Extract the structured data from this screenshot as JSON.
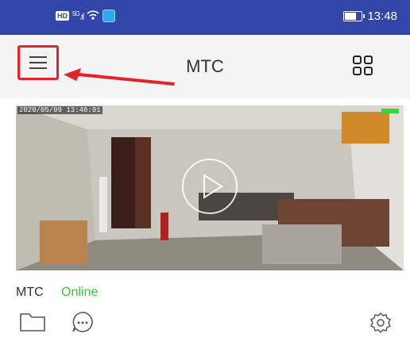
{
  "status_bar": {
    "hd_label": "HD",
    "network_label": "5G",
    "time": "13:48",
    "battery_level": 0.75,
    "background_color": "#3146a8"
  },
  "app_bar": {
    "title": "MTC",
    "menu_icon": "hamburger-menu-icon",
    "layout_icon": "grid-layout-icon",
    "highlight_color": "#e3242b"
  },
  "camera": {
    "timestamp": "2020/05/09 13:48:01",
    "play_icon": "play-icon"
  },
  "device": {
    "name": "MTC",
    "status": "Online",
    "status_color": "#3bc43b"
  },
  "actions": {
    "folder_icon": "folder-icon",
    "message_icon": "message-icon",
    "settings_icon": "settings-icon"
  }
}
